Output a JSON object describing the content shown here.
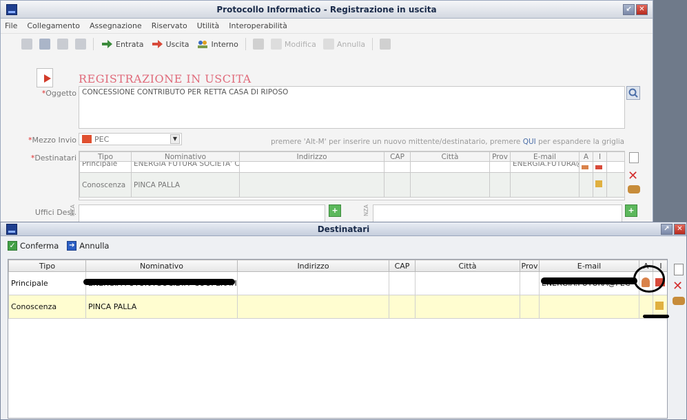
{
  "main_window": {
    "title": "Protocollo Informatico - Registrazione in uscita",
    "menu": [
      "File",
      "Collegamento",
      "Assegnazione",
      "Riservato",
      "Utilità",
      "Interoperabilità"
    ],
    "toolbar": {
      "entrata": "Entrata",
      "uscita": "Uscita",
      "interno": "Interno",
      "modifica": "Modifica",
      "annulla": "Annulla"
    },
    "heading": "REGISTRAZIONE IN USCITA",
    "oggetto_label": "Oggetto",
    "oggetto_value": "CONCESSIONE CONTRIBUTO PER RETTA CASA DI RIPOSO",
    "mezzo_label": "Mezzo Invio",
    "mezzo_value": "PEC",
    "hint_before": "premere 'Alt-M' per inserire un nuovo mittente/destinatario, premere ",
    "hint_link": "QUI",
    "hint_after": " per espandere la griglia",
    "destinatari_label": "Destinatari",
    "grid_headers": [
      "Tipo",
      "Nominativo",
      "Indirizzo",
      "CAP",
      "Città",
      "Prov",
      "E-mail",
      "A",
      "I"
    ],
    "grid_rows": [
      {
        "tipo": "Principale",
        "nominativo": "ENERGIA FUTURA SOCIETA' COOP",
        "email": "ENERGIA.FUTURA@"
      },
      {
        "tipo": "Conoscenza",
        "nominativo": "PINCA PALLA",
        "email": ""
      }
    ],
    "uffici_label": "Uffici Dest.",
    "side_vertical_text": "NZA"
  },
  "dialog": {
    "title": "Destinatari",
    "conferma": "Conferma",
    "annulla": "Annulla",
    "headers": [
      "Tipo",
      "Nominativo",
      "Indirizzo",
      "CAP",
      "Città",
      "Prov",
      "E-mail",
      "A",
      "I"
    ],
    "rows": [
      {
        "tipo": "Principale",
        "nominativo": "ENERGIA FUTURA SOCIETA' COOPERATI",
        "email": "ENERGIA.FUTURA@PEC"
      },
      {
        "tipo": "Conoscenza",
        "nominativo": "PINCA PALLA",
        "email": ""
      }
    ]
  }
}
